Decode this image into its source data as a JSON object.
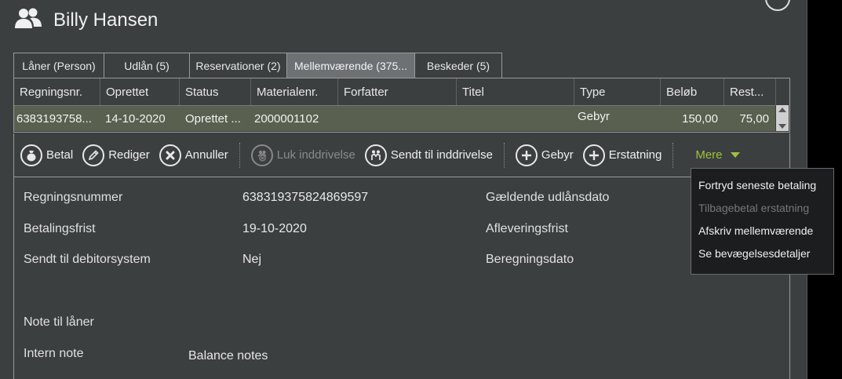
{
  "header": {
    "title": "Billy Hansen",
    "icon": "users-icon"
  },
  "tabs": [
    {
      "label": "Låner (Person)",
      "active": false
    },
    {
      "label": "Udlån (5)",
      "active": false
    },
    {
      "label": "Reservationer (2)",
      "active": false
    },
    {
      "label": "Mellemværende (375...",
      "active": true
    },
    {
      "label": "Beskeder (5)",
      "active": false
    }
  ],
  "grid": {
    "columns": [
      "Regningsnr.",
      "Oprettet",
      "Status",
      "Materialenr.",
      "Forfatter",
      "Titel",
      "Type",
      "Beløb",
      "Rest..."
    ],
    "rows": [
      {
        "regningsnr": "6383193758...",
        "oprettet": "14-10-2020",
        "status": "Oprettet ...",
        "materialenr": "2000001102",
        "forfatter": "",
        "titel": "",
        "type": "Gebyr",
        "beloeb": "150,00",
        "rest": "75,00"
      }
    ]
  },
  "toolbar": {
    "betal": "Betal",
    "rediger": "Rediger",
    "annuller": "Annuller",
    "luk": "Luk inddrivelse",
    "sendt": "Sendt til inddrivelse",
    "gebyr": "Gebyr",
    "erstatning": "Erstatning",
    "mere": "Mere"
  },
  "details": {
    "regningsnummer_label": "Regningsnummer",
    "regningsnummer_value": "638319375824869597",
    "betalingsfrist_label": "Betalingsfrist",
    "betalingsfrist_value": "19-10-2020",
    "debitor_label": "Sendt til debitorsystem",
    "debitor_value": "Nej",
    "gaeldende_label": "Gældende udlånsdato",
    "aflevering_label": "Afleveringsfrist",
    "beregning_label": "Beregningsdato",
    "note_label": "Note til låner",
    "intern_label": "Intern note",
    "intern_value": "Balance notes"
  },
  "menu": [
    {
      "label": "Fortryd seneste betaling",
      "enabled": true
    },
    {
      "label": "Tilbagebetal erstatning",
      "enabled": false
    },
    {
      "label": "Afskriv mellemværende",
      "enabled": true
    },
    {
      "label": "Se bevægelsesdetaljer",
      "enabled": true
    }
  ],
  "colors": {
    "accent": "#9dc23c",
    "background": "#3c3f40",
    "selected_row": "#59604f",
    "active_tab": "#6e7174"
  }
}
